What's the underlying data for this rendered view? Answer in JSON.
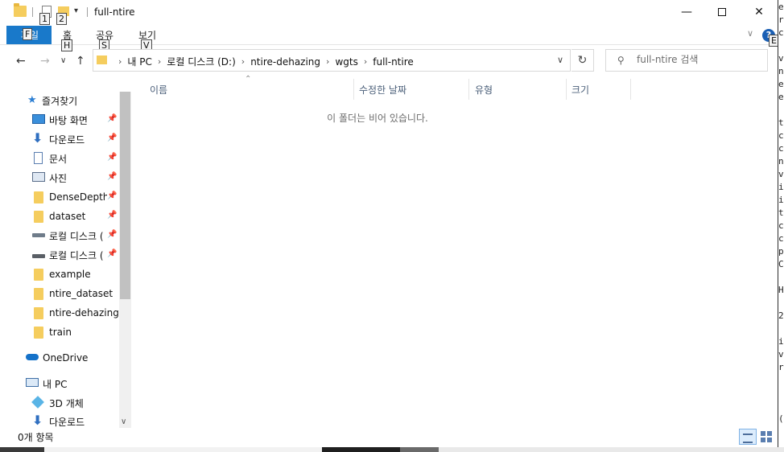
{
  "window": {
    "title": "full-ntire",
    "keytips": {
      "qa1": "1",
      "qa2": "2",
      "file": "F",
      "home": "H",
      "share": "S",
      "view": "V",
      "expand": "E"
    }
  },
  "ribbon": {
    "file_label": "파일",
    "tabs": [
      "홈",
      "공유",
      "보기"
    ]
  },
  "address": {
    "crumbs": [
      "내 PC",
      "로컬 디스크 (D:)",
      "ntire-dehazing",
      "wgts",
      "full-ntire"
    ]
  },
  "search": {
    "placeholder": "full-ntire 검색"
  },
  "sidebar": {
    "quick_access": "즐겨찾기",
    "quick_items": [
      "바탕 화면",
      "다운로드",
      "문서",
      "사진",
      "DenseDepth-",
      "dataset",
      "로컬 디스크 (",
      "로컬 디스크 (",
      "example",
      "ntire_dataset",
      "ntire-dehazing",
      "train"
    ],
    "onedrive": "OneDrive",
    "this_pc": "내 PC",
    "pc_items": [
      "3D 개체",
      "다운로드"
    ]
  },
  "columns": [
    "이름",
    "수정한 날짜",
    "유형",
    "크기"
  ],
  "content": {
    "empty_message": "이 폴더는 비어 있습니다."
  },
  "status": {
    "item_count": "0개 항목"
  },
  "edge_chars": [
    "e",
    "r",
    "c",
    "v",
    "n",
    "e",
    "e",
    "t",
    "c",
    "c",
    "n",
    "v",
    "i",
    "i",
    "t",
    "c",
    "c",
    "p",
    "C",
    "H",
    "2",
    "i",
    "v",
    "r",
    "("
  ],
  "colors": {
    "accent": "#1979ca",
    "folder": "#f5cd5e",
    "header_text": "#4c607a"
  }
}
